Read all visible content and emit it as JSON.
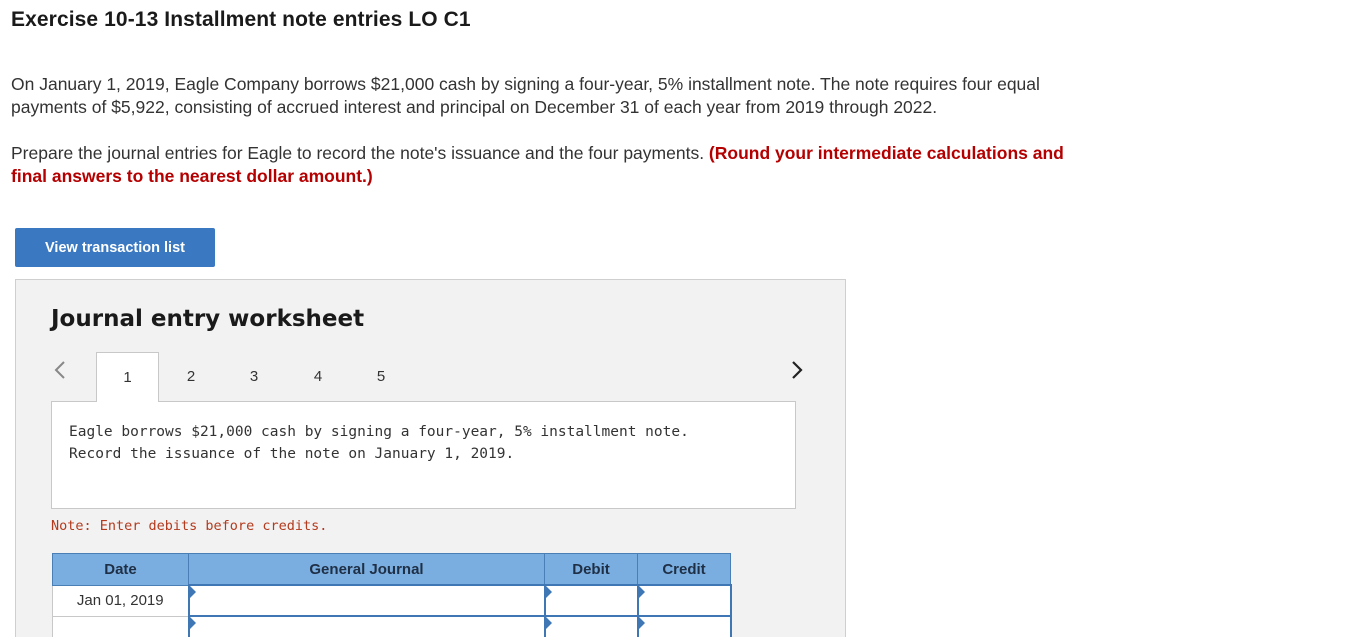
{
  "header": {
    "title": "Exercise 10-13 Installment note entries LO C1"
  },
  "problem": {
    "paragraph1_line1": "On January 1, 2019, Eagle Company borrows $21,000 cash by signing a four-year, 5% installment note. The note requires four equal",
    "paragraph1_line2": "payments of $5,922, consisting of accrued interest and principal on December 31 of each year from 2019 through 2022.",
    "paragraph2": "Prepare the journal entries for Eagle to record the note's issuance and the four payments. ",
    "paragraph2_warning_line1": "(Round your intermediate calculations and",
    "paragraph2_warning_line2": "final answers to the nearest dollar amount.)"
  },
  "actions": {
    "view_transaction_list": "View transaction list"
  },
  "worksheet": {
    "title": "Journal entry worksheet",
    "tabs": [
      "1",
      "2",
      "3",
      "4",
      "5"
    ],
    "active_tab": 0,
    "description_line1": "Eagle borrows $21,000 cash by signing a four-year, 5% installment note.",
    "description_line2": "Record the issuance of the note on January 1, 2019.",
    "note": "Note: Enter debits before credits."
  },
  "journal_table": {
    "headers": {
      "date": "Date",
      "general_journal": "General Journal",
      "debit": "Debit",
      "credit": "Credit"
    },
    "rows": [
      {
        "date": "Jan 01, 2019"
      },
      {
        "date": ""
      }
    ]
  },
  "colors": {
    "button": "#3a78c2",
    "warning": "#b40000",
    "table_header": "#7aaee0",
    "input_border": "#3f77b5",
    "note": "#b33a1d"
  }
}
